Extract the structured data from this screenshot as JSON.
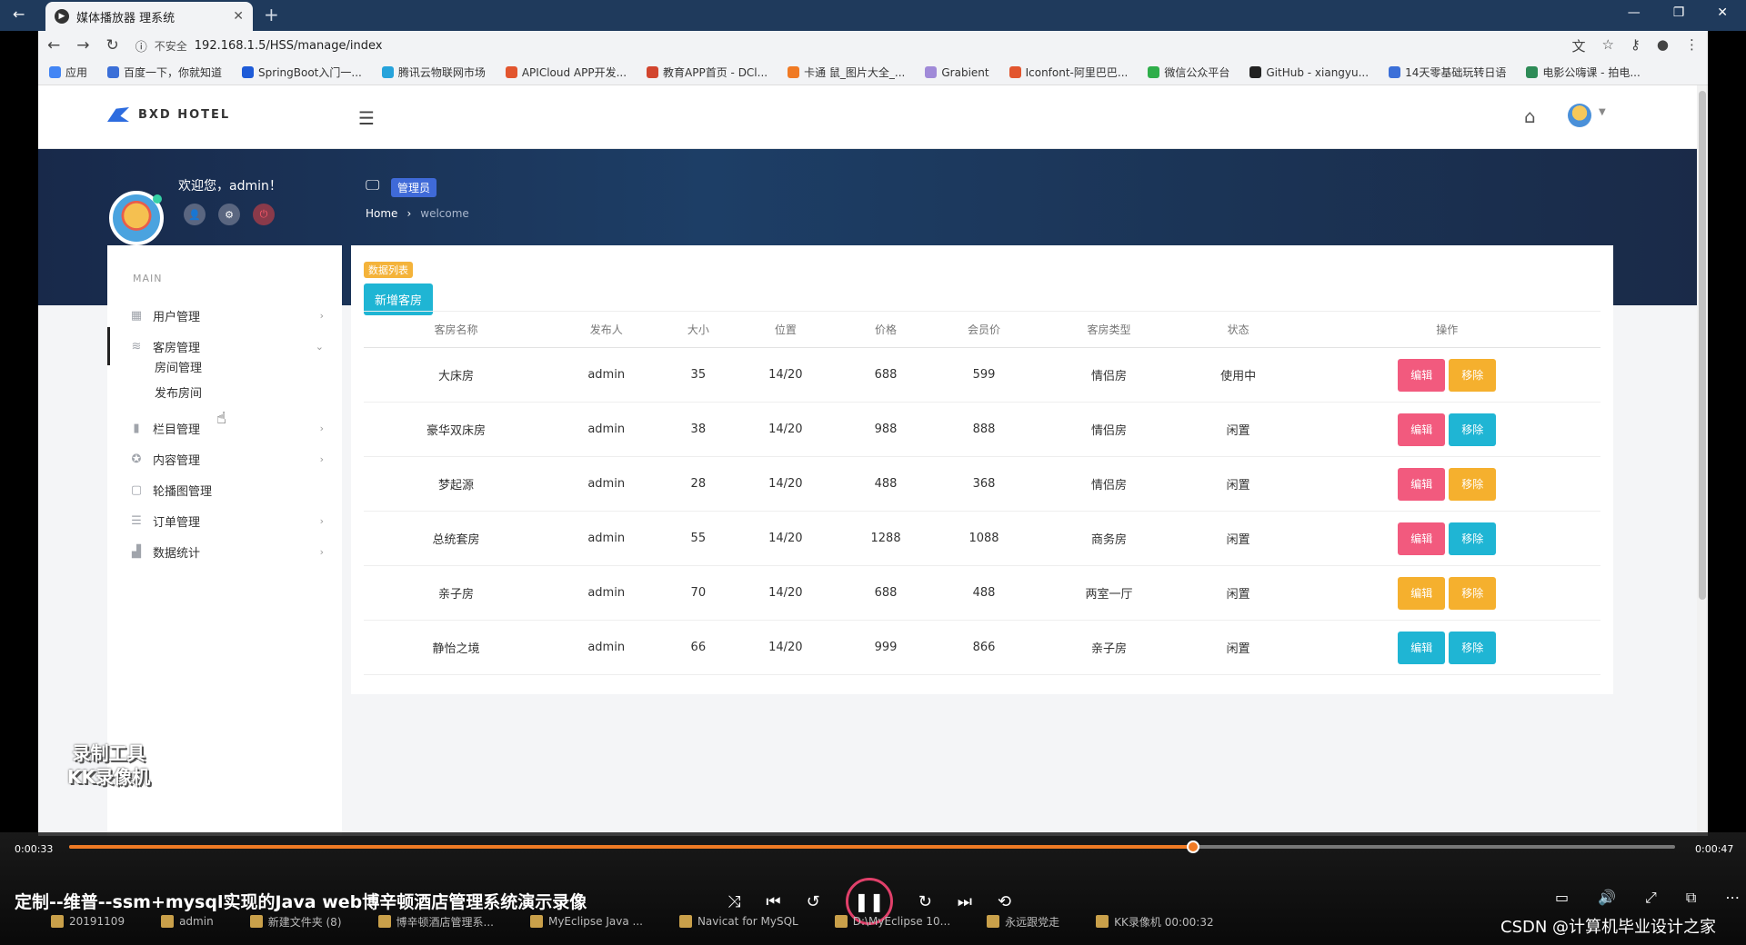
{
  "browser": {
    "tab_title": "媒体播放器 理系统",
    "new_tab": "+",
    "insecure_label": "不安全",
    "url": "192.168.1.5/HSS/manage/index",
    "bookmarks": [
      "应用",
      "百度一下，你就知道",
      "SpringBoot入门一...",
      "腾讯云物联网市场",
      "APICloud APP开发...",
      "教育APP首页 - DCl...",
      "卡通 鼠_图片大全_...",
      "Grabient",
      "Iconfont-阿里巴巴...",
      "微信公众平台",
      "GitHub - xiangyu...",
      "14天零基础玩转日语",
      "电影公嗨课 - 拍电..."
    ]
  },
  "app": {
    "logo_text": "BXD HOTEL",
    "welcome": "欢迎您，admin！",
    "role_badge": "管理员",
    "breadcrumb": {
      "home": "Home",
      "current": "welcome"
    }
  },
  "sidebar": {
    "section_label": "MAIN",
    "items": [
      {
        "label": "用户管理",
        "icon": "grid-icon"
      },
      {
        "label": "客房管理",
        "icon": "layers-icon"
      },
      {
        "label": "栏目管理",
        "icon": "file-icon"
      },
      {
        "label": "内容管理",
        "icon": "badge-icon"
      },
      {
        "label": "轮播图管理",
        "icon": "clipboard-icon"
      },
      {
        "label": "订单管理",
        "icon": "list-icon"
      },
      {
        "label": "数据统计",
        "icon": "bar-chart-icon"
      }
    ],
    "sub_items": [
      "房间管理",
      "发布房间"
    ]
  },
  "content": {
    "list_tag": "数据列表",
    "add_button": "新增客房",
    "columns": [
      "客房名称",
      "发布人",
      "大小",
      "位置",
      "价格",
      "会员价",
      "客房类型",
      "状态",
      "操作"
    ],
    "rows": [
      {
        "cells": [
          "大床房",
          "admin",
          "35",
          "14/20",
          "688",
          "599",
          "情侣房",
          "使用中"
        ],
        "edit": "编辑",
        "remove": "移除",
        "edit_color": "#f25a7e",
        "remove_color": "#f5b02e"
      },
      {
        "cells": [
          "豪华双床房",
          "admin",
          "38",
          "14/20",
          "988",
          "888",
          "情侣房",
          "闲置"
        ],
        "edit": "编辑",
        "remove": "移除",
        "edit_color": "#f25a7e",
        "remove_color": "#1fb5d4"
      },
      {
        "cells": [
          "梦起源",
          "admin",
          "28",
          "14/20",
          "488",
          "368",
          "情侣房",
          "闲置"
        ],
        "edit": "编辑",
        "remove": "移除",
        "edit_color": "#f25a7e",
        "remove_color": "#f5b02e"
      },
      {
        "cells": [
          "总统套房",
          "admin",
          "55",
          "14/20",
          "1288",
          "1088",
          "商务房",
          "闲置"
        ],
        "edit": "编辑",
        "remove": "移除",
        "edit_color": "#f25a7e",
        "remove_color": "#1fb5d4"
      },
      {
        "cells": [
          "亲子房",
          "admin",
          "70",
          "14/20",
          "688",
          "488",
          "两室一厅",
          "闲置"
        ],
        "edit": "编辑",
        "remove": "移除",
        "edit_color": "#f5b02e",
        "remove_color": "#f5b02e"
      },
      {
        "cells": [
          "静怡之境",
          "admin",
          "66",
          "14/20",
          "999",
          "866",
          "亲子房",
          "闲置"
        ],
        "edit": "编辑",
        "remove": "移除",
        "edit_color": "#1fb5d4",
        "remove_color": "#1fb5d4"
      }
    ]
  },
  "watermark": {
    "line1": "录制工具",
    "line2": "KK录像机"
  },
  "video": {
    "current_time": "0:00:33",
    "total_time": "0:00:47",
    "progress": 0.7,
    "title": "定制--维普--ssm+mysql实现的Java web博辛顿酒店管理系统演示录像"
  },
  "taskbar": [
    "20191109",
    "admin",
    "新建文件夹 (8)",
    "博辛顿酒店管理系...",
    "MyEclipse Java ...",
    "Navicat for MySQL",
    "D:\\MyEclipse 10...",
    "永远跟党走",
    "KK录像机 00:00:32"
  ],
  "credit": "CSDN @计算机毕业设计之家"
}
